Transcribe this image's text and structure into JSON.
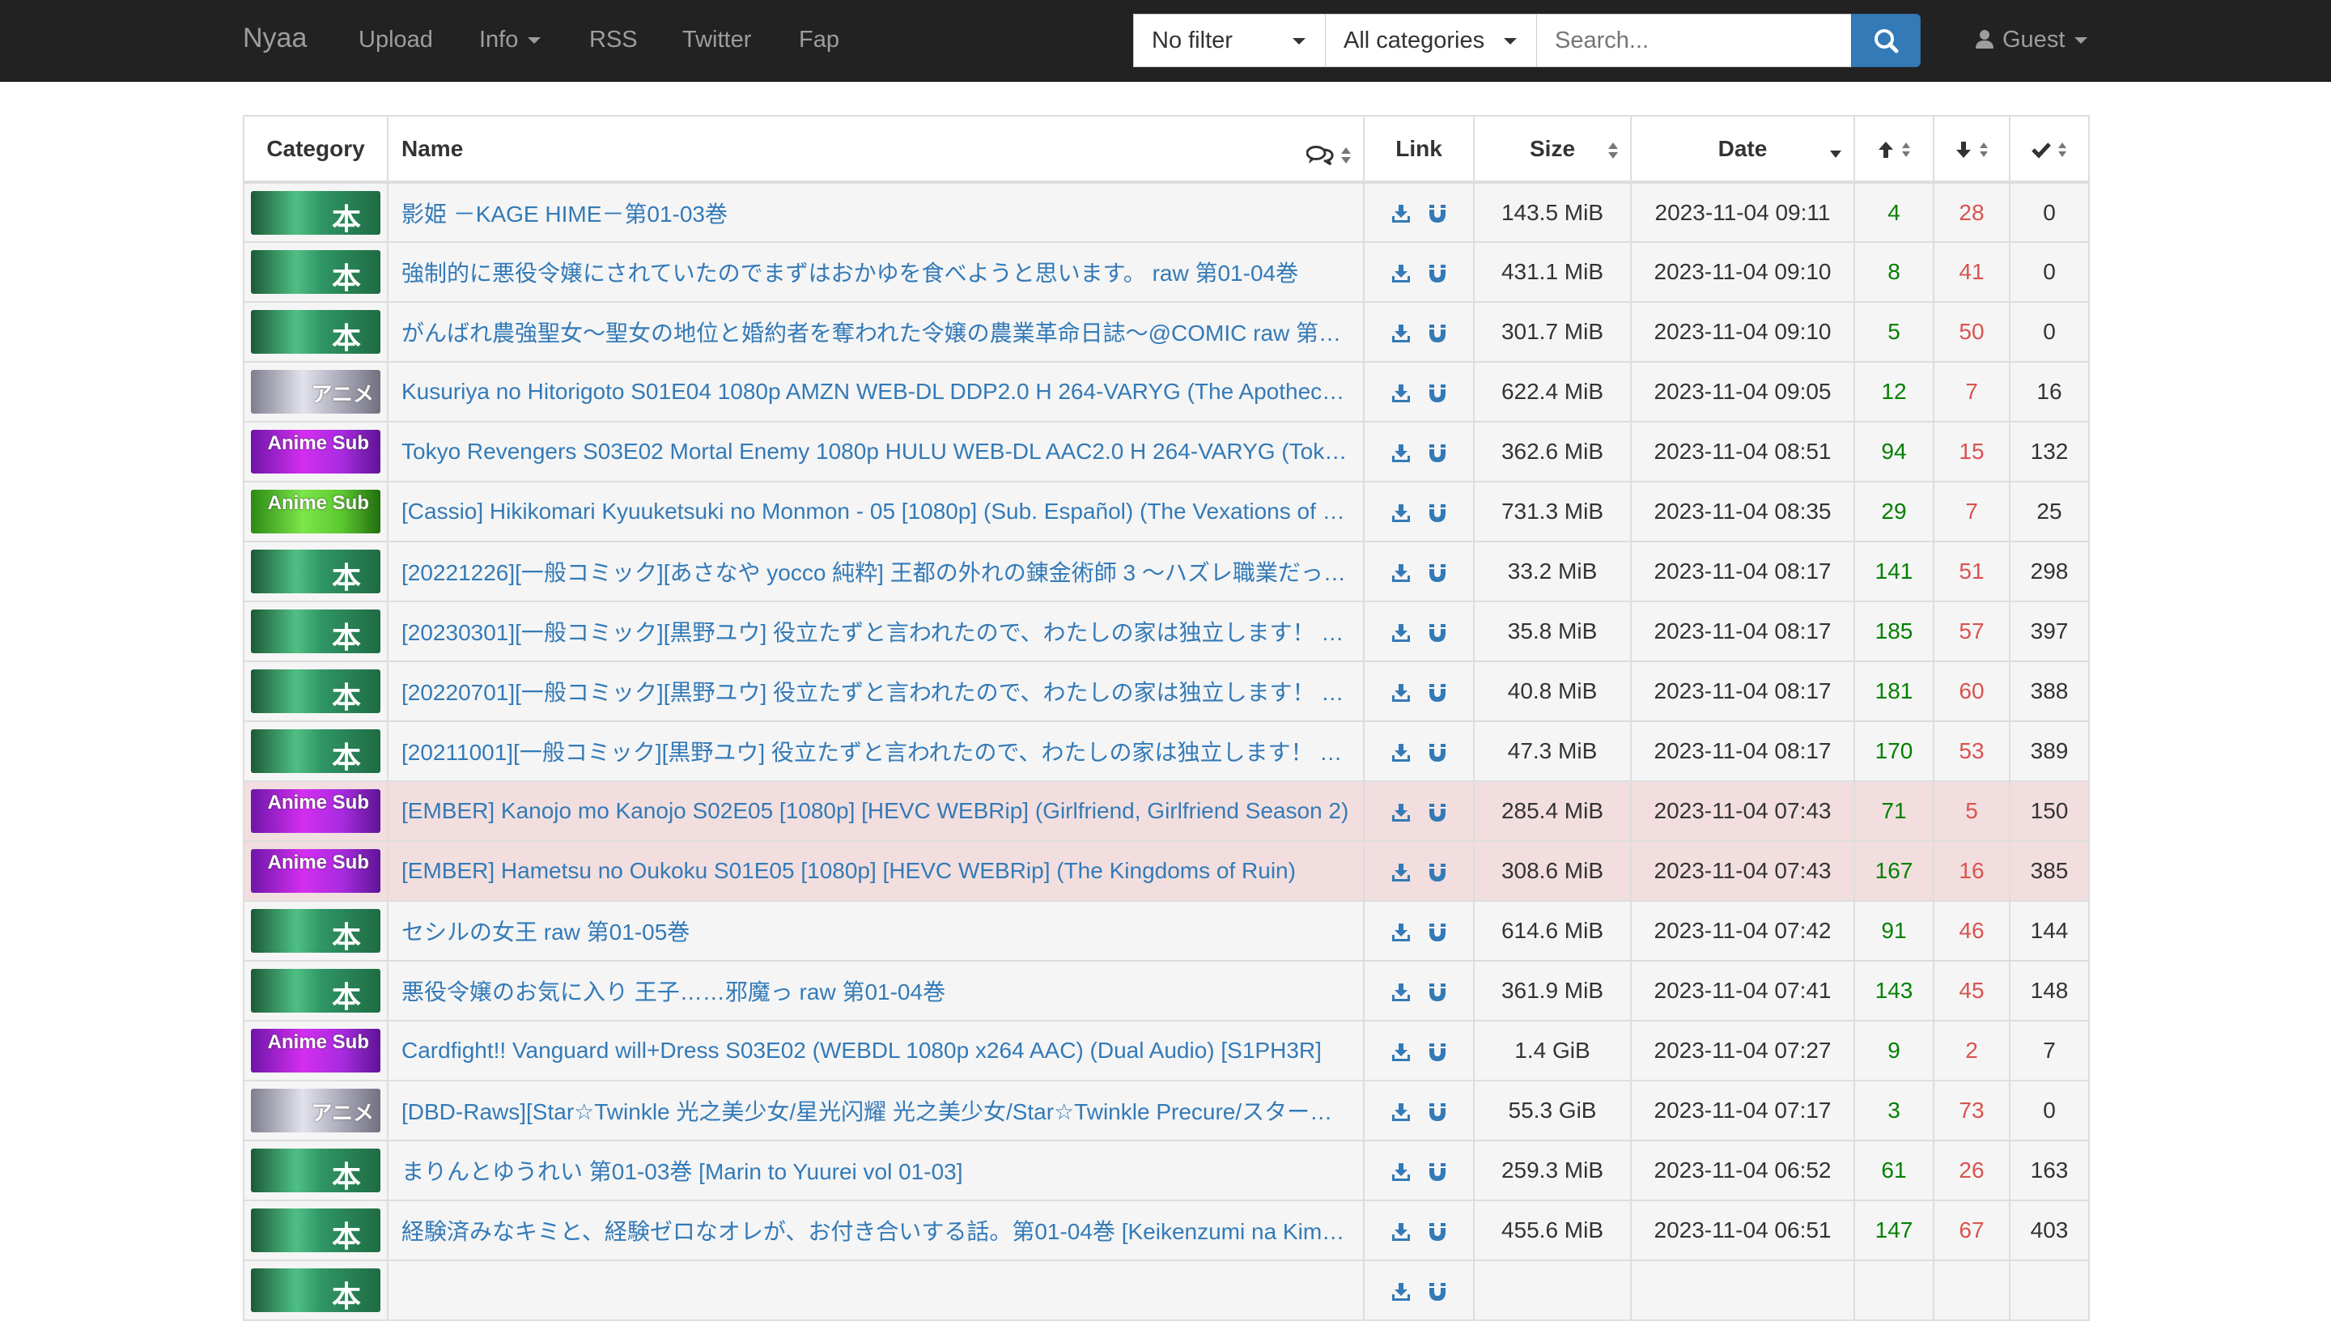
{
  "nav": {
    "brand": "Nyaa",
    "upload": "Upload",
    "info": "Info",
    "rss": "RSS",
    "twitter": "Twitter",
    "fap": "Fap",
    "filter_value": "No filter",
    "category_value": "All categories",
    "search_placeholder": "Search...",
    "guest": "Guest"
  },
  "table": {
    "headers": {
      "category": "Category",
      "name": "Name",
      "link": "Link",
      "size": "Size",
      "date": "Date"
    },
    "rows": [
      {
        "cat": "literature",
        "cat_text": "本",
        "name": "影姫 －KAGE HIME－第01-03巻",
        "size": "143.5 MiB",
        "date": "2023-11-04 09:11",
        "seeders": "4",
        "leechers": "28",
        "completed": "0",
        "status": "default"
      },
      {
        "cat": "literature",
        "cat_text": "本",
        "name": "強制的に悪役令嬢にされていたのでまずはおかゆを食べようと思います。 raw 第01-04巻",
        "size": "431.1 MiB",
        "date": "2023-11-04 09:10",
        "seeders": "8",
        "leechers": "41",
        "completed": "0",
        "status": "default"
      },
      {
        "cat": "literature",
        "cat_text": "本",
        "name": "がんばれ農強聖女～聖女の地位と婚約者を奪われた令嬢の農業革命日誌～@COMIC raw 第…",
        "size": "301.7 MiB",
        "date": "2023-11-04 09:10",
        "seeders": "5",
        "leechers": "50",
        "completed": "0",
        "status": "default"
      },
      {
        "cat": "raw",
        "cat_text": "アニメ",
        "name": "Kusuriya no Hitorigoto S01E04 1080p AMZN WEB-DL DDP2.0 H 264-VARYG (The Apothec…",
        "size": "622.4 MiB",
        "date": "2023-11-04 09:05",
        "seeders": "12",
        "leechers": "7",
        "completed": "16",
        "status": "default"
      },
      {
        "cat": "sub-purple",
        "cat_text": "Anime Sub",
        "name": "Tokyo Revengers S03E02 Mortal Enemy 1080p HULU WEB-DL AAC2.0 H 264-VARYG (Tok…",
        "size": "362.6 MiB",
        "date": "2023-11-04 08:51",
        "seeders": "94",
        "leechers": "15",
        "completed": "132",
        "status": "default"
      },
      {
        "cat": "sub-green",
        "cat_text": "Anime Sub",
        "name": "[Cassio] Hikikomari Kyuuketsuki no Monmon - 05 [1080p] (Sub. Español) (The Vexations of …",
        "size": "731.3 MiB",
        "date": "2023-11-04 08:35",
        "seeders": "29",
        "leechers": "7",
        "completed": "25",
        "status": "default"
      },
      {
        "cat": "literature",
        "cat_text": "本",
        "name": "[20221226][一般コミック][あさなや yocco 純粋] 王都の外れの錬金術師 3 ～ハズレ職業だっ…",
        "size": "33.2 MiB",
        "date": "2023-11-04 08:17",
        "seeders": "141",
        "leechers": "51",
        "completed": "298",
        "status": "default"
      },
      {
        "cat": "literature",
        "cat_text": "本",
        "name": "[20230301][一般コミック][黒野ユウ] 役立たずと言われたので、わたしの家は独立します！ …",
        "size": "35.8 MiB",
        "date": "2023-11-04 08:17",
        "seeders": "185",
        "leechers": "57",
        "completed": "397",
        "status": "default"
      },
      {
        "cat": "literature",
        "cat_text": "本",
        "name": "[20220701][一般コミック][黒野ユウ] 役立たずと言われたので、わたしの家は独立します！ …",
        "size": "40.8 MiB",
        "date": "2023-11-04 08:17",
        "seeders": "181",
        "leechers": "60",
        "completed": "388",
        "status": "default"
      },
      {
        "cat": "literature",
        "cat_text": "本",
        "name": "[20211001][一般コミック][黒野ユウ] 役立たずと言われたので、わたしの家は独立します！ …",
        "size": "47.3 MiB",
        "date": "2023-11-04 08:17",
        "seeders": "170",
        "leechers": "53",
        "completed": "389",
        "status": "default"
      },
      {
        "cat": "sub-purple",
        "cat_text": "Anime Sub",
        "name": "[EMBER] Kanojo mo Kanojo S02E05 [1080p] [HEVC WEBRip] (Girlfriend, Girlfriend Season 2)",
        "size": "285.4 MiB",
        "date": "2023-11-04 07:43",
        "seeders": "71",
        "leechers": "5",
        "completed": "150",
        "status": "danger"
      },
      {
        "cat": "sub-purple",
        "cat_text": "Anime Sub",
        "name": "[EMBER] Hametsu no Oukoku S01E05 [1080p] [HEVC WEBRip] (The Kingdoms of Ruin)",
        "size": "308.6 MiB",
        "date": "2023-11-04 07:43",
        "seeders": "167",
        "leechers": "16",
        "completed": "385",
        "status": "danger"
      },
      {
        "cat": "literature",
        "cat_text": "本",
        "name": "セシルの女王 raw 第01-05巻",
        "size": "614.6 MiB",
        "date": "2023-11-04 07:42",
        "seeders": "91",
        "leechers": "46",
        "completed": "144",
        "status": "default"
      },
      {
        "cat": "literature",
        "cat_text": "本",
        "name": "悪役令嬢のお気に入り 王子……邪魔っ raw 第01-04巻",
        "size": "361.9 MiB",
        "date": "2023-11-04 07:41",
        "seeders": "143",
        "leechers": "45",
        "completed": "148",
        "status": "default"
      },
      {
        "cat": "sub-purple",
        "cat_text": "Anime Sub",
        "name": "Cardfight!! Vanguard will+Dress S03E02 (WEBDL 1080p x264 AAC) (Dual Audio) [S1PH3R]",
        "size": "1.4 GiB",
        "date": "2023-11-04 07:27",
        "seeders": "9",
        "leechers": "2",
        "completed": "7",
        "status": "default"
      },
      {
        "cat": "raw",
        "cat_text": "アニメ",
        "name": "[DBD-Raws][Star☆Twinkle 光之美少女/星光闪耀 光之美少女/Star☆Twinkle Precure/スター…",
        "size": "55.3 GiB",
        "date": "2023-11-04 07:17",
        "seeders": "3",
        "leechers": "73",
        "completed": "0",
        "status": "default"
      },
      {
        "cat": "literature",
        "cat_text": "本",
        "name": "まりんとゆうれい 第01-03巻 [Marin to Yuurei vol 01-03]",
        "size": "259.3 MiB",
        "date": "2023-11-04 06:52",
        "seeders": "61",
        "leechers": "26",
        "completed": "163",
        "status": "default"
      },
      {
        "cat": "literature",
        "cat_text": "本",
        "name": "経験済みなキミと、経験ゼロなオレが、お付き合いする話。第01-04巻 [Keikenzumi na Kim…",
        "size": "455.6 MiB",
        "date": "2023-11-04 06:51",
        "seeders": "147",
        "leechers": "67",
        "completed": "403",
        "status": "default"
      },
      {
        "cat": "literature",
        "cat_text": "本",
        "name": "",
        "size": "",
        "date": "",
        "seeders": "",
        "leechers": "",
        "completed": "",
        "status": "default"
      }
    ]
  },
  "colors": {
    "navbar_bg": "#222222",
    "link": "#337ab7",
    "seeders": "#008000",
    "leechers": "#d9534f",
    "danger_row": "#f2dede",
    "default_row": "#f5f5f5"
  },
  "icons": {
    "comments": "comments-icon",
    "sort": "sort-icon",
    "sort_desc": "sort-desc-icon",
    "seeders": "arrow-up-icon",
    "leechers": "arrow-down-icon",
    "completed": "check-icon",
    "download": "download-icon",
    "magnet": "magnet-icon",
    "search": "search-icon",
    "user": "user-icon"
  }
}
